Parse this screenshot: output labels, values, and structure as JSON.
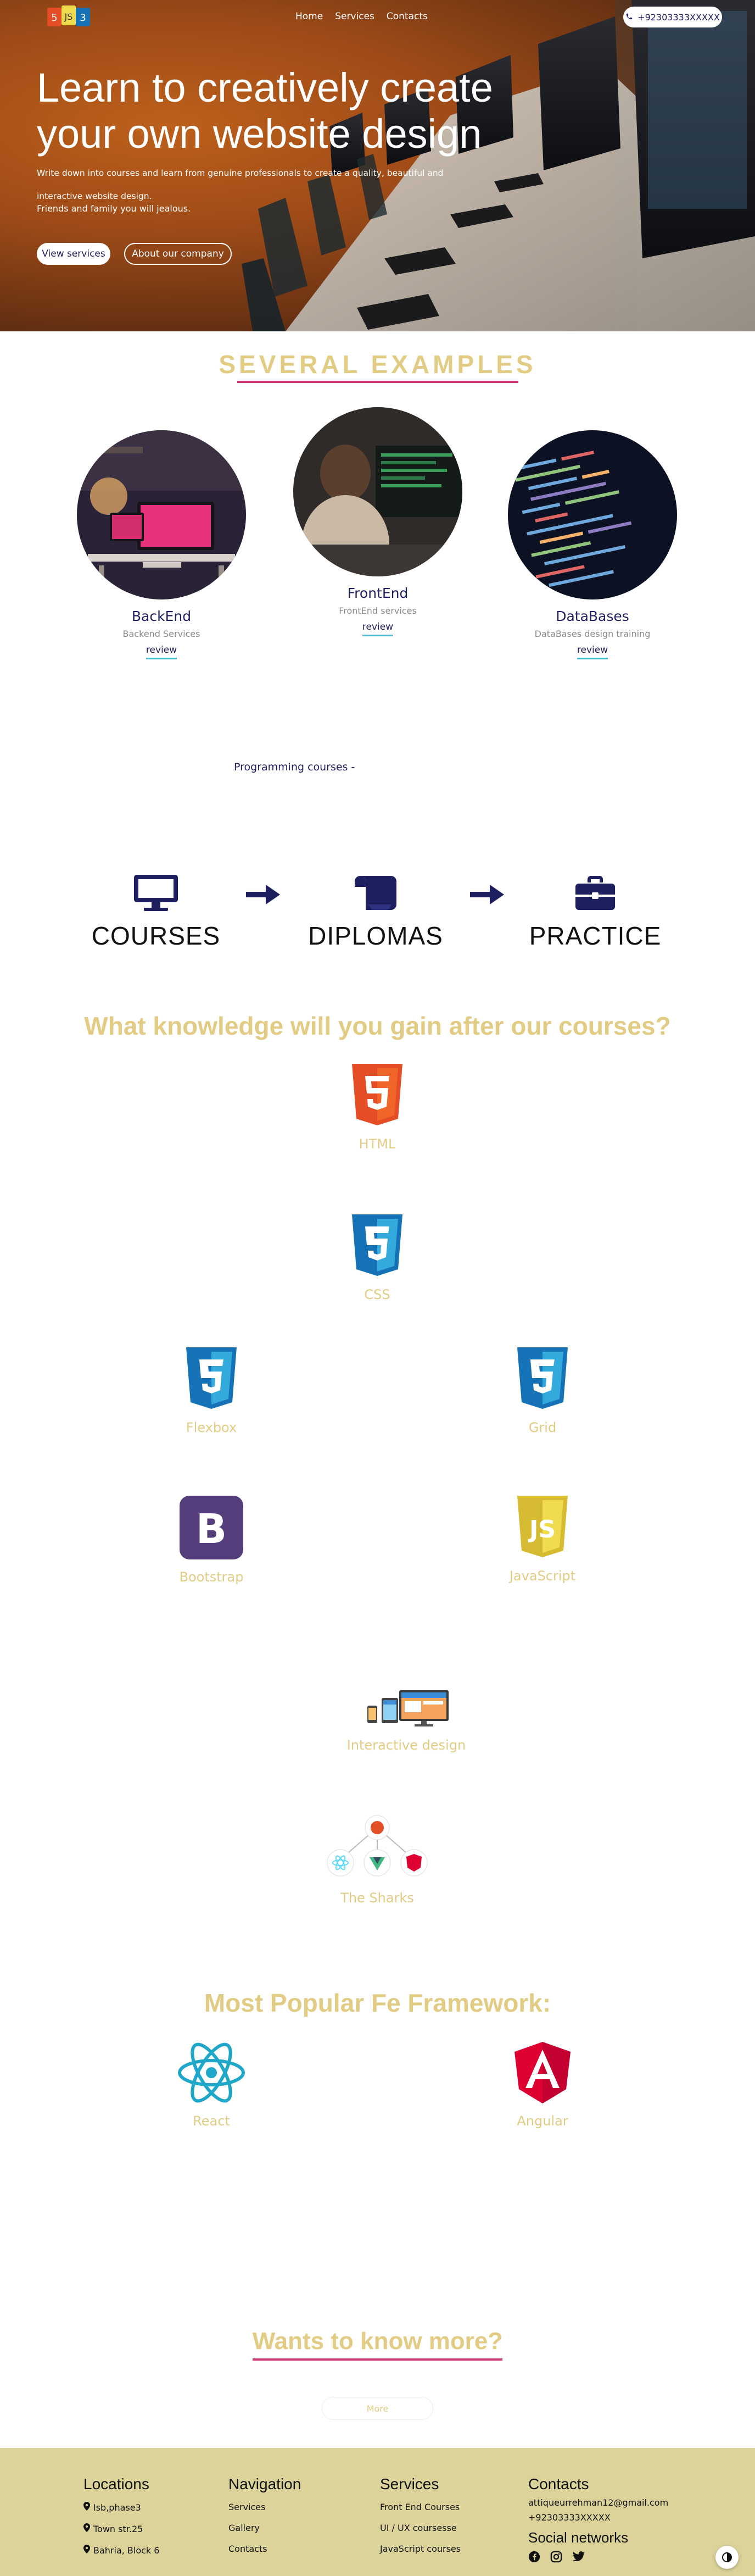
{
  "colors": {
    "navy": "#1d1f5e",
    "gold": "#e2cc84",
    "accent_rule": "#c93d73",
    "review_rule": "#3fb8c9",
    "footer_bg": "#dbd39a"
  },
  "nav": {
    "links": [
      "Home",
      "Services",
      "Contacts"
    ],
    "phone": "+92303333XXXXX",
    "phone_icon": "phone-icon",
    "logo_icon": "html-css-js-logo-icon"
  },
  "hero": {
    "title_line1": "Learn to creatively create",
    "title_line2": "your own website design",
    "lead": "Write down into courses and learn from genuine professionals to create a quality, beautiful and interactive website design.",
    "lead2": "Friends and family you will jealous.",
    "btn_services": "View services",
    "btn_about": "About our company"
  },
  "examples": {
    "title": "SEVERAL EXAMPLES",
    "cards": [
      {
        "name": "BackEnd",
        "sub": "Backend Services",
        "review": "review"
      },
      {
        "name": "FrontEnd",
        "sub": "FrontEnd services",
        "review": "review"
      },
      {
        "name": "DataBases",
        "sub": "DataBases design training",
        "review": "review"
      }
    ]
  },
  "programming": "Programming courses -",
  "steps": {
    "items": [
      {
        "label": "COURSES",
        "icon": "desktop-icon"
      },
      {
        "label": "DIPLOMAS",
        "icon": "scroll-icon"
      },
      {
        "label": "PRACTICE",
        "icon": "briefcase-icon"
      }
    ],
    "arrow_icon": "arrow-right-icon"
  },
  "knowledge": {
    "title": "What knowledge will you gain after our courses?",
    "items": [
      {
        "name": "HTML",
        "icon": "html5-icon"
      },
      {
        "name": "CSS",
        "icon": "css3-icon"
      },
      {
        "name": "Flexbox",
        "icon": "css3-icon"
      },
      {
        "name": "Grid",
        "icon": "css3-icon"
      },
      {
        "name": "Bootstrap",
        "icon": "bootstrap-icon"
      },
      {
        "name": "JavaScript",
        "icon": "javascript-icon"
      },
      {
        "name": "Interactive design",
        "icon": "responsive-devices-icon"
      },
      {
        "name": "The Sharks",
        "icon": "frameworks-icon"
      }
    ]
  },
  "frameworks": {
    "title": "Most Popular Fe Framework:",
    "items": [
      {
        "name": "React",
        "icon": "react-icon"
      },
      {
        "name": "Angular",
        "icon": "angular-icon"
      }
    ]
  },
  "more": {
    "title": "Wants to know more?",
    "button": "More"
  },
  "footer": {
    "locations": {
      "title": "Locations",
      "items": [
        "Isb,phase3",
        "Town str.25",
        "Bahria, Block 6"
      ]
    },
    "navigation": {
      "title": "Navigation",
      "items": [
        "Services",
        "Gallery",
        "Contacts"
      ]
    },
    "services": {
      "title": "Services",
      "items": [
        "Front End Courses",
        "UI / UX coursesse",
        "JavaScript courses"
      ]
    },
    "contacts": {
      "title": "Contacts",
      "email": "attiqueurrehman12@gmail.com",
      "phone": "+92303333XXXXX"
    },
    "social": {
      "title": "Social networks",
      "icons": [
        "facebook-icon",
        "instagram-icon",
        "twitter-icon"
      ]
    }
  },
  "theme_toggle_icon": "contrast-icon"
}
